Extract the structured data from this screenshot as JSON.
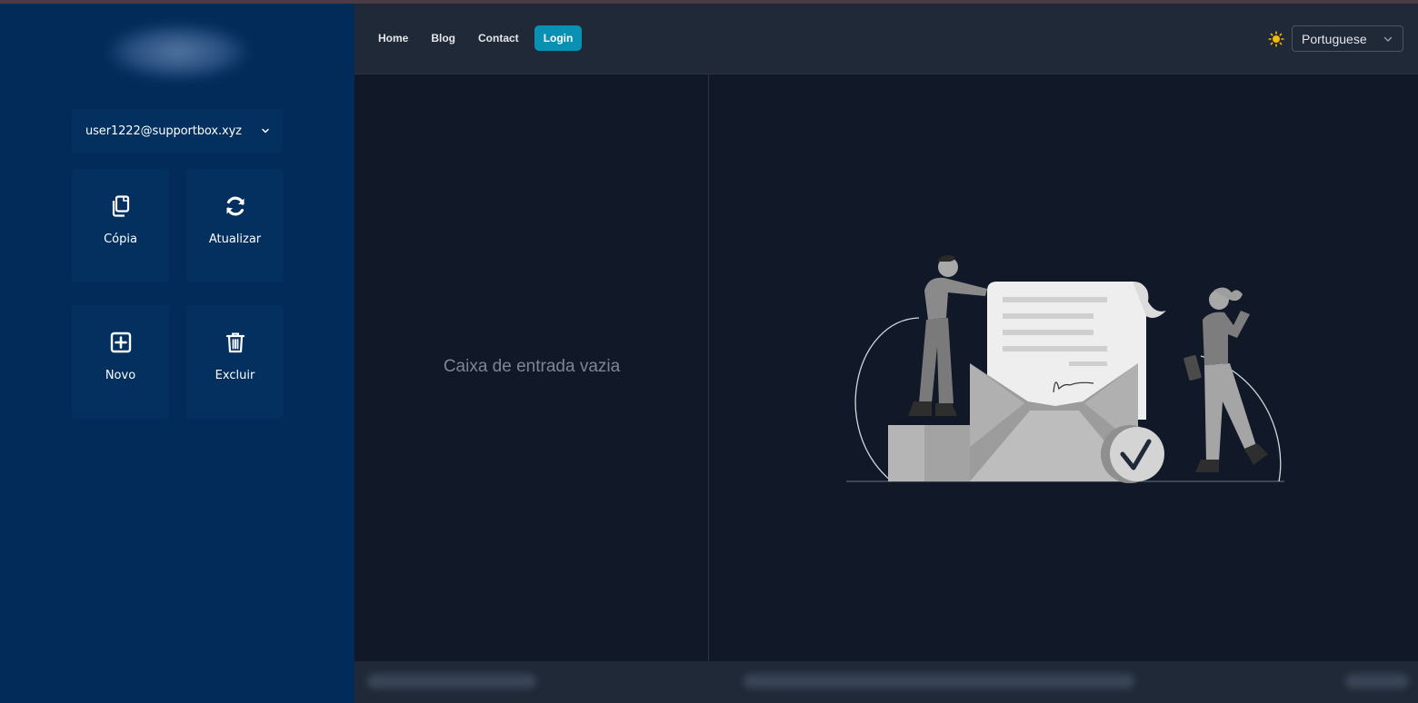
{
  "sidebar": {
    "account_email": "user1222@supportbox.xyz",
    "actions": [
      {
        "label": "Cópia",
        "icon": "copy-icon"
      },
      {
        "label": "Atualizar",
        "icon": "refresh-icon"
      },
      {
        "label": "Novo",
        "icon": "plus-square-icon"
      },
      {
        "label": "Excluir",
        "icon": "trash-icon"
      }
    ]
  },
  "header": {
    "nav": [
      {
        "label": "Home"
      },
      {
        "label": "Blog"
      },
      {
        "label": "Contact"
      },
      {
        "label": "Login"
      }
    ],
    "theme_icon": "sun-icon",
    "language": "Portuguese"
  },
  "inbox": {
    "empty_message": "Caixa de entrada vazia"
  },
  "colors": {
    "sidebar_bg": "#022b59",
    "header_bg": "#1f2937",
    "main_bg": "#111827",
    "accent": "#0891b2",
    "sun": "#f5b90a"
  }
}
